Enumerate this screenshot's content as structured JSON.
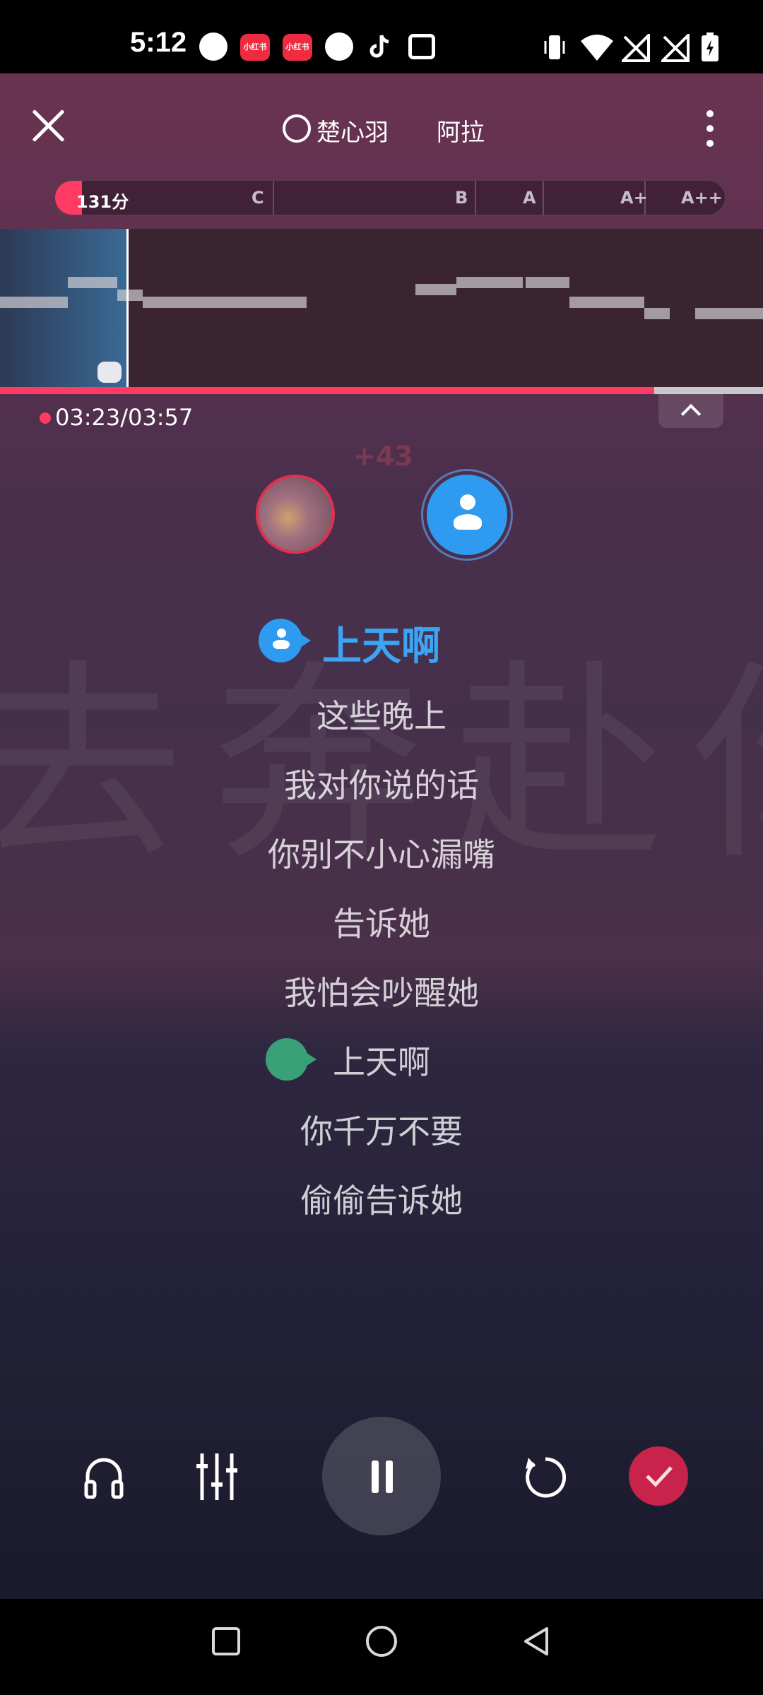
{
  "status_bar": {
    "time": "5:12",
    "app_badge_label": "小红书"
  },
  "header": {
    "singer_a": "楚心羽",
    "singer_b": "阿拉"
  },
  "score": {
    "points": "131分",
    "grades": [
      "C",
      "B",
      "A",
      "A+",
      "A++"
    ],
    "fill_fraction": 0.03
  },
  "playback": {
    "time": "03:23/03:57",
    "progress_fraction": 0.857,
    "bonus": "+43"
  },
  "lyrics": {
    "active": "上天啊",
    "lines": [
      "这些晚上",
      "我对你说的话",
      "你别不小心漏嘴",
      "告诉她",
      "我怕会吵醒她"
    ],
    "part_a_line": "上天啊",
    "after_lines": [
      "你千万不要",
      "偷偷告诉她"
    ]
  },
  "watermark": "去奔赴你",
  "colors": {
    "accent": "#ff3b64",
    "active_lyric": "#3aa5f5",
    "done_button": "#c8234a"
  }
}
